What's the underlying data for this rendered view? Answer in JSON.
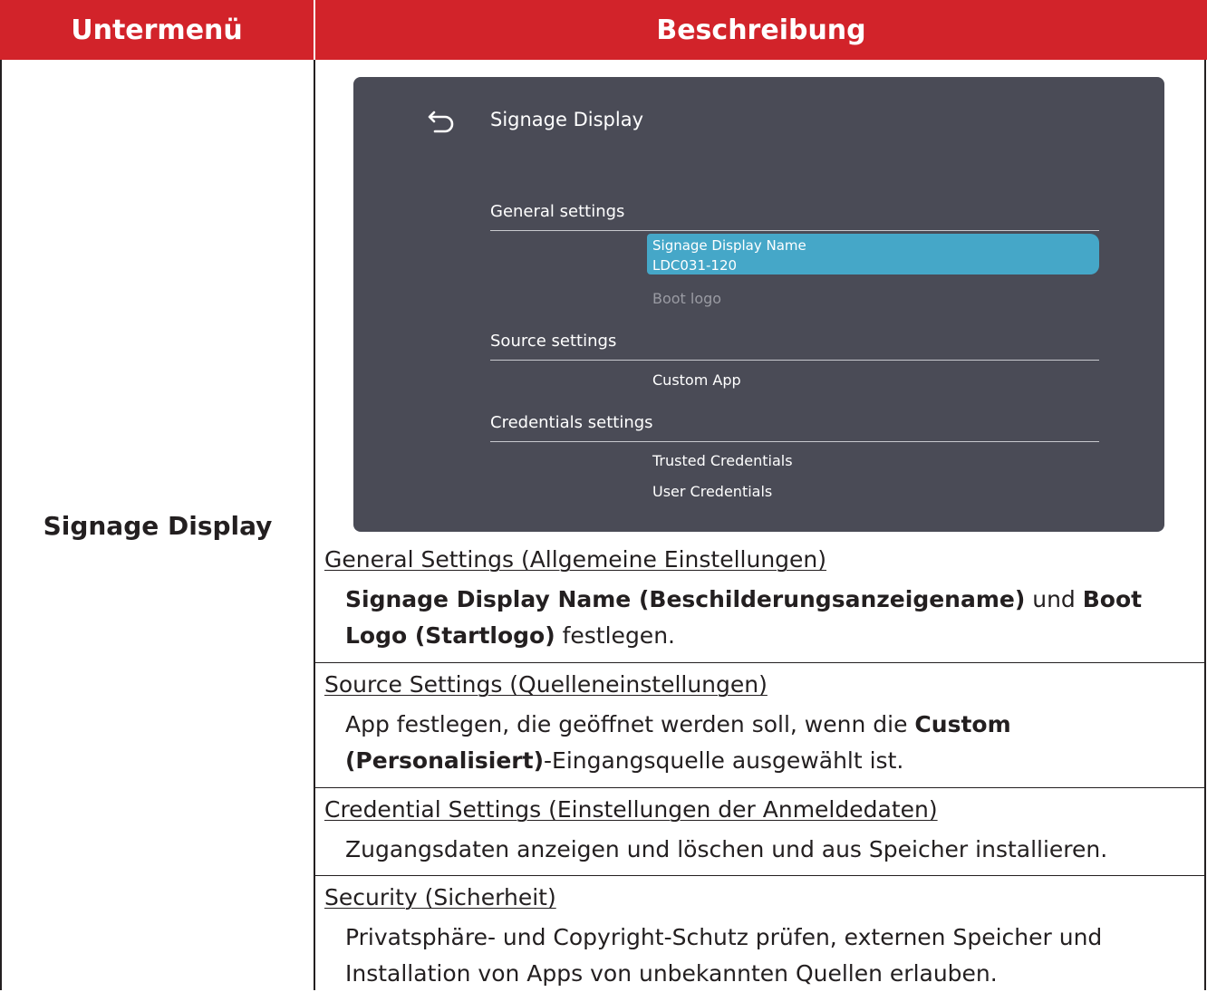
{
  "table": {
    "header": {
      "col1": "Untermenü",
      "col2": "Beschreibung"
    },
    "row": {
      "submenu": "Signage Display"
    }
  },
  "screen": {
    "title": "Signage Display",
    "sections": {
      "general": "General settings",
      "source": "Source settings",
      "credentials": "Credentials settings"
    },
    "items": {
      "selected_label": "Signage Display Name",
      "selected_value": "LDC031-120",
      "boot_logo": "Boot logo",
      "custom_app": "Custom App",
      "trusted": "Trusted Credentials",
      "user": "User Credentials"
    },
    "colors": {
      "background": "#4a4b56",
      "selection": "#45a7c8"
    }
  },
  "description": {
    "general": {
      "heading": "General Settings (Allgemeine Einstellungen)",
      "b1": "Signage Display Name (Beschilderungsanzeigename)",
      "t1": " und ",
      "b2": "Boot Logo (Startlogo)",
      "t2": " festlegen."
    },
    "source": {
      "heading": "Source Settings (Quelleneinstellungen)",
      "t1": "App festlegen, die geöffnet werden soll, wenn die ",
      "b1": "Custom (Personalisiert)",
      "t2": "-Eingangsquelle ausgewählt ist."
    },
    "credential": {
      "heading": "Credential Settings (Einstellungen der Anmeldedaten)",
      "t1": "Zugangsdaten anzeigen und löschen und aus Speicher installieren."
    },
    "security": {
      "heading": "Security (Sicherheit)",
      "t1": "Privatsphäre- und Copyright-Schutz prüfen, externen Speicher und Installation von Apps von unbekannten Quellen erlauben."
    }
  },
  "colors": {
    "header": "#d2232a",
    "text": "#231f20"
  }
}
